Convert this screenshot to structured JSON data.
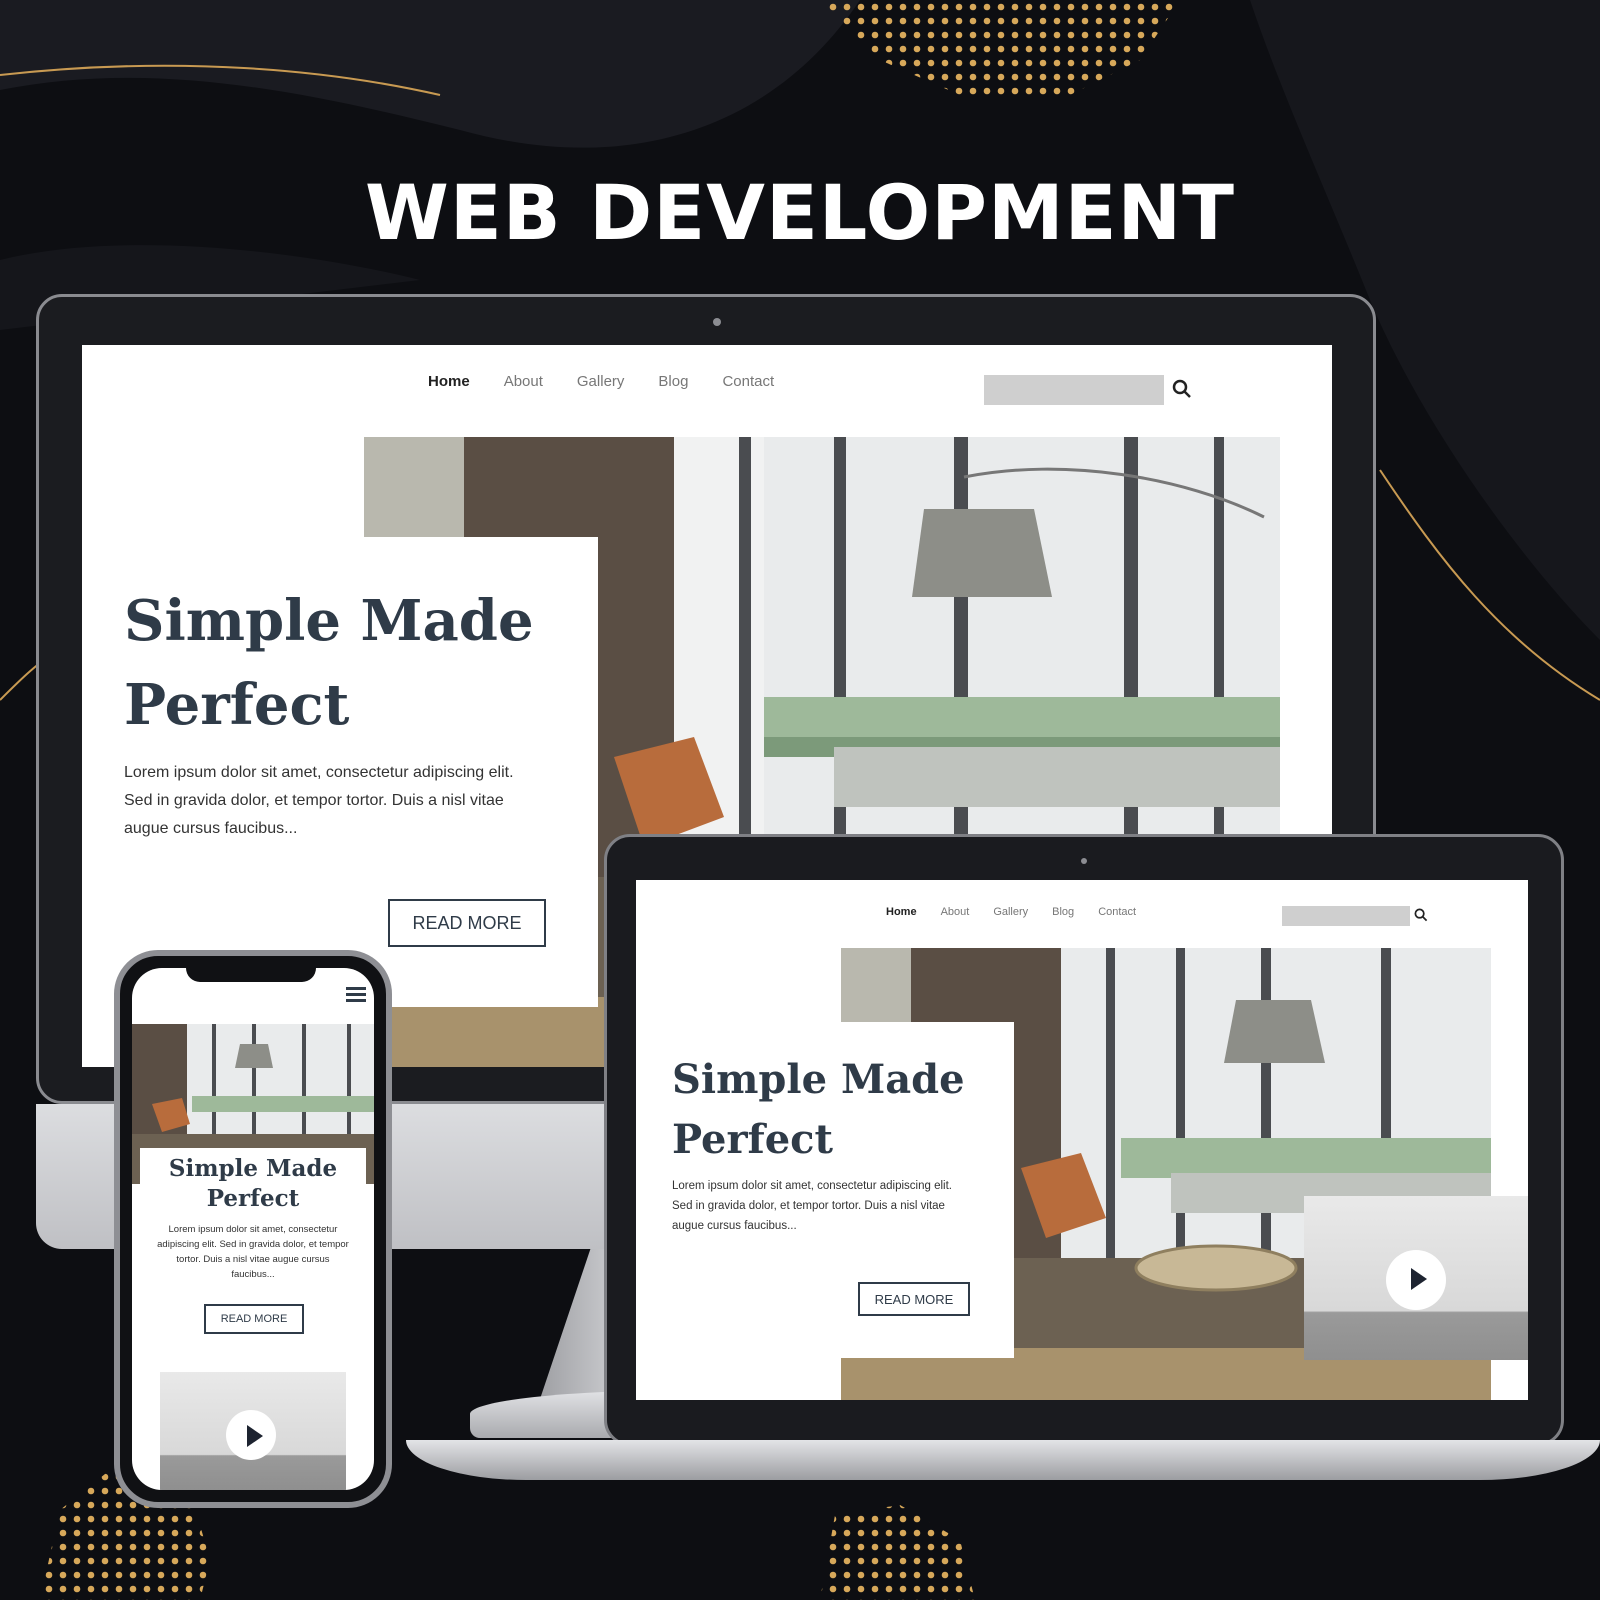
{
  "banner": {
    "title": "WEB DEVELOPMENT"
  },
  "site": {
    "nav": [
      "Home",
      "About",
      "Gallery",
      "Blog",
      "Contact"
    ],
    "search_placeholder": "",
    "hero_title_line1": "Simple Made",
    "hero_title_line2": "Perfect",
    "hero_text": "Lorem ipsum dolor sit amet, consectetur adipiscing elit. Sed in gravida dolor, et tempor tortor. Duis a nisl vitae augue cursus faucibus...",
    "cta_label": "READ MORE"
  },
  "colors": {
    "background": "#0d0e12",
    "accent_gold": "#d7a85a",
    "heading": "#2f3b48",
    "search_field": "#cfcfcf"
  },
  "icons": [
    "search-icon",
    "hamburger-menu-icon",
    "play-icon"
  ]
}
